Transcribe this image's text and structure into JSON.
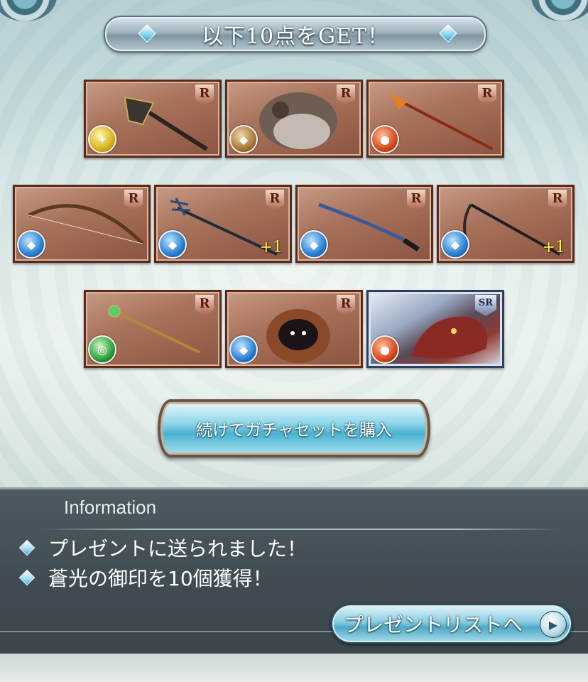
{
  "header": {
    "title": "以下10点をGET！"
  },
  "rewards": [
    {
      "rarity": "R",
      "element": "light",
      "plus": ""
    },
    {
      "rarity": "R",
      "element": "earth",
      "plus": ""
    },
    {
      "rarity": "R",
      "element": "fire",
      "plus": ""
    },
    {
      "rarity": "R",
      "element": "water",
      "plus": ""
    },
    {
      "rarity": "R",
      "element": "water",
      "plus": "+1"
    },
    {
      "rarity": "R",
      "element": "water",
      "plus": ""
    },
    {
      "rarity": "R",
      "element": "water",
      "plus": "+1"
    },
    {
      "rarity": "R",
      "element": "wind",
      "plus": ""
    },
    {
      "rarity": "R",
      "element": "water",
      "plus": ""
    },
    {
      "rarity": "SR",
      "element": "fire",
      "plus": ""
    }
  ],
  "actions": {
    "buy_again_label": "続けてガチャセットを購入"
  },
  "info": {
    "heading": "Information",
    "lines": [
      "プレゼントに送られました！",
      "蒼光の御印を10個獲得！"
    ],
    "present_list_label": "プレゼントリストへ"
  },
  "colors": {
    "card_frame": "#5c2a18",
    "button_blue": "#4cb2d2",
    "panel_bg": "#3c464b",
    "plus_text": "#fff24a"
  }
}
